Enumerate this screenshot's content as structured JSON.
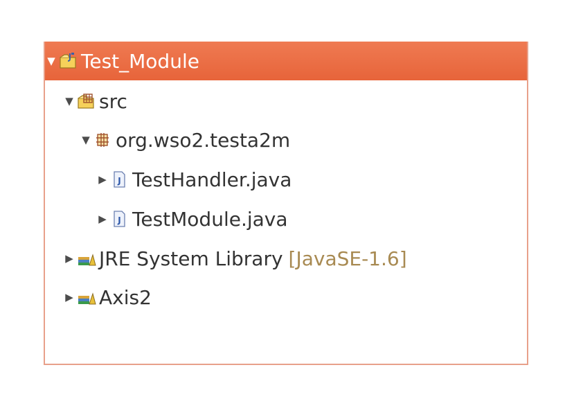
{
  "tree": {
    "project": {
      "label": "Test_Module",
      "icon": "java-project-folder-icon",
      "expanded": true
    },
    "src": {
      "label": "src",
      "icon": "source-folder-icon",
      "expanded": true
    },
    "package": {
      "label": "org.wso2.testa2m",
      "icon": "package-icon",
      "expanded": true
    },
    "files": [
      {
        "label": "TestHandler.java",
        "icon": "java-file-icon",
        "expanded": false
      },
      {
        "label": "TestModule.java",
        "icon": "java-file-icon",
        "expanded": false
      }
    ],
    "libraries": [
      {
        "label": "JRE System Library",
        "qualifier": "[JavaSE-1.6]",
        "icon": "library-icon",
        "expanded": false
      },
      {
        "label": "Axis2",
        "icon": "library-icon",
        "expanded": false
      }
    ]
  },
  "colors": {
    "selection": "#e96a40",
    "border": "#e8a08a",
    "text": "#333333",
    "qualifier": "#a88a52"
  }
}
